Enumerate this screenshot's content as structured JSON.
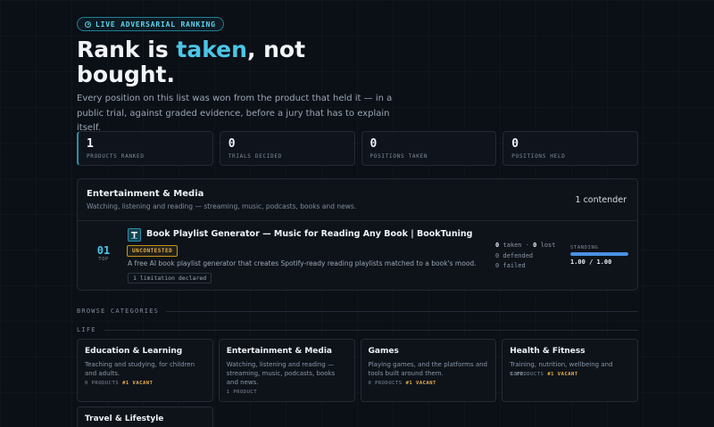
{
  "hero": {
    "badge": "LIVE ADVERSARIAL RANKING",
    "title_a": "Rank is ",
    "title_accent": "taken",
    "title_b": ", not bought.",
    "subtitle": "Every position on this list was won from the product that held it — in a public trial, against graded evidence, before a jury that has to explain itself."
  },
  "stats": [
    {
      "value": "1",
      "label": "PRODUCTS RANKED"
    },
    {
      "value": "0",
      "label": "TRIALS DECIDED"
    },
    {
      "value": "0",
      "label": "POSITIONS TAKEN"
    },
    {
      "value": "0",
      "label": "POSITIONS HELD"
    }
  ],
  "category": {
    "title": "Entertainment & Media",
    "description": "Watching, listening and reading — streaming, music, podcasts, books and news.",
    "count": "1 contender",
    "entry": {
      "rank": "01",
      "rank_label": "TOP",
      "title": "Book Playlist Generator — Music for Reading Any Book | BookTuning",
      "status": "UNCONTESTED",
      "description": "A free AI book playlist generator that creates Spotify-ready reading playlists matched to a book's mood.",
      "limitation": "1 limitation declared",
      "record_taken": "0",
      "record_taken_label": "taken",
      "record_sep": "·",
      "record_lost": "0",
      "record_lost_label": "lost",
      "defended": "0 defended",
      "failed": "0 failed",
      "standing_label": "STANDING",
      "standing_value": "1.00 / 1.00",
      "standing_fraction": 1.0
    }
  },
  "browse": {
    "heading": "BROWSE CATEGORIES",
    "group": "LIFE",
    "cards": [
      {
        "title": "Education & Learning",
        "desc": "Teaching and studying, for children and adults.",
        "products": "0 PRODUCTS",
        "vacant": "#1 VACANT"
      },
      {
        "title": "Entertainment & Media",
        "desc": "Watching, listening and reading — streaming, music, podcasts, books and news.",
        "products": "1 PRODUCT",
        "vacant": ""
      },
      {
        "title": "Games",
        "desc": "Playing games, and the platforms and tools built around them.",
        "products": "0 PRODUCTS",
        "vacant": "#1 VACANT"
      },
      {
        "title": "Health & Fitness",
        "desc": "Training, nutrition, wellbeing and care.",
        "products": "0 PRODUCTS",
        "vacant": "#1 VACANT"
      }
    ],
    "extra_card": {
      "title": "Travel & Lifestyle"
    }
  }
}
